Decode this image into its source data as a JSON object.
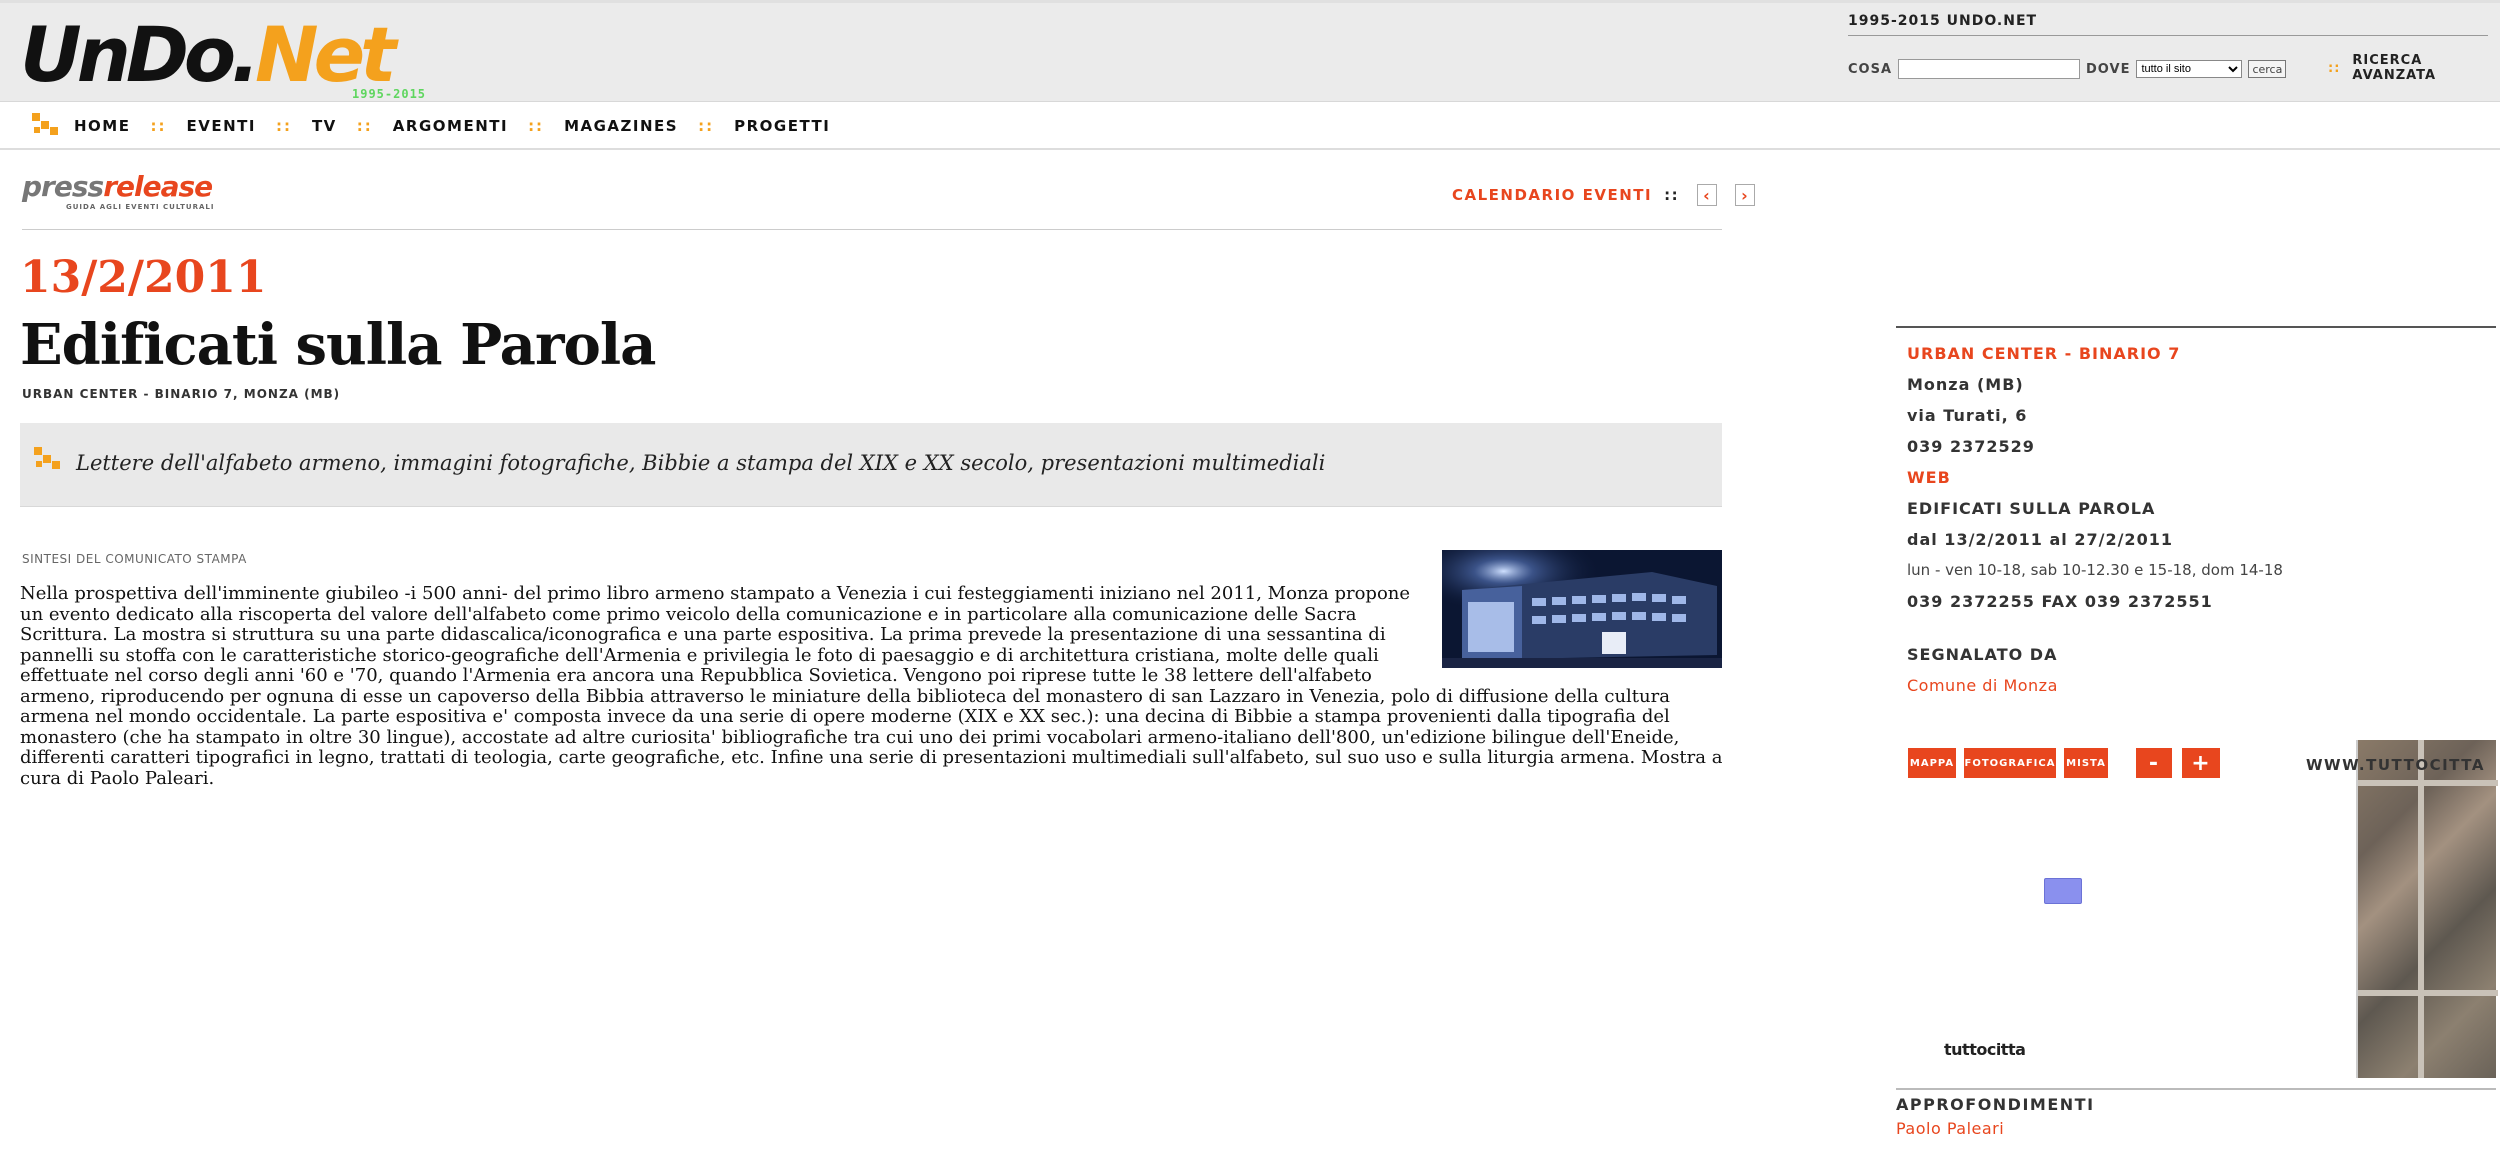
{
  "header": {
    "logo_part1": "UnDo.",
    "logo_part2": "Net",
    "logo_years": "1995-2015",
    "brand_text": "1995-2015 UNDO.NET",
    "search": {
      "cosa_label": "COSA",
      "cosa_value": "",
      "dove_label": "DOVE",
      "dove_selected": "tutto il sito",
      "button_label": "cerca"
    },
    "advanced_dots": "::",
    "advanced_line1": "RICERCA",
    "advanced_line2": "AVANZATA"
  },
  "nav": {
    "separator": "::",
    "items": [
      "HOME",
      "EVENTI",
      "TV",
      "ARGOMENTI",
      "MAGAZINES",
      "PROGETTI"
    ]
  },
  "pressrelease": {
    "part1": "press",
    "part2": "release",
    "tagline": "GUIDA AGLI EVENTI CULTURALI"
  },
  "calendar": {
    "label": "CALENDARIO EVENTI",
    "separator": "::",
    "prev": "‹",
    "next": "›"
  },
  "event": {
    "date": "13/2/2011",
    "title": "Edificati sulla Parola",
    "venue_line": "URBAN CENTER - BINARIO 7, MONZA (MB)",
    "subtitle": "Lettere dell'alfabeto armeno, immagini fotografiche, Bibbie a stampa del XIX e XX secolo, presentazioni multimediali",
    "sintesi_label": "SINTESI DEL COMUNICATO STAMPA",
    "body": "Nella prospettiva dell'imminente giubileo -i 500 anni- del primo libro armeno stampato a Venezia i cui festeggiamenti iniziano nel 2011, Monza propone un evento dedicato alla riscoperta del valore dell'alfabeto come primo veicolo della comunicazione e in particolare alla comunicazione delle Sacra Scrittura. La mostra si struttura su una parte didascalica/iconografica e una parte espositiva. La prima prevede la presentazione di una sessantina di pannelli su stoffa con le caratteristiche storico-geografiche dell'Armenia e privilegia le foto di paesaggio e di architettura cristiana, molte delle quali effettuate nel corso degli anni '60 e '70, quando l'Armenia era ancora una Repubblica Sovietica. Vengono poi riprese tutte le 38 lettere dell'alfabeto armeno, riproducendo per ognuna di esse un capoverso della Bibbia attraverso le miniature della biblioteca del monastero di san Lazzaro in Venezia, polo di diffusione della cultura armena nel mondo occidentale. La parte espositiva e' composta invece da una serie di opere moderne (XIX e XX sec.): una decina di Bibbie a stampa provenienti dalla tipografia del monastero (che ha stampato in oltre 30 lingue), accostate ad altre curiosita' bibliografiche tra cui uno dei primi vocabolari armeno-italiano dell'800, un'edizione bilingue dell'Eneide, differenti caratteri tipografici in legno, trattati di teologia, carte geografiche, etc. Infine una serie di presentazioni multimediali sull'alfabeto, sul suo uso e sulla liturgia armena. Mostra a cura di Paolo Paleari."
  },
  "sidebar": {
    "venue_name": "URBAN CENTER - BINARIO 7",
    "city": "Monza (MB)",
    "address": "via Turati, 6",
    "phone": "039 2372529",
    "web": "WEB",
    "event_title": "EDIFICATI SULLA PAROLA",
    "dates": "dal 13/2/2011 al 27/2/2011",
    "hours": "lun - ven 10-18, sab 10-12.30 e 15-18, dom 14-18",
    "phone_fax": "039 2372255 FAX 039 2372551",
    "segnalato_label": "SEGNALATO DA",
    "segnalato_link": "Comune di Monza"
  },
  "map": {
    "btn_mappa": "MAPPA",
    "btn_foto": "FOTOGRAFICA",
    "btn_mista": "MISTA",
    "btn_minus": "-",
    "btn_plus": "+",
    "www": "WWW.TUTTOCITTA",
    "provider": "tuttocitta"
  },
  "approfondimenti": {
    "label": "APPROFONDIMENTI",
    "link": "Paolo Paleari"
  },
  "colors": {
    "accent_orange": "#e8461e",
    "logo_orange": "#f4a11d",
    "nav_sep": "#f4a11d"
  }
}
